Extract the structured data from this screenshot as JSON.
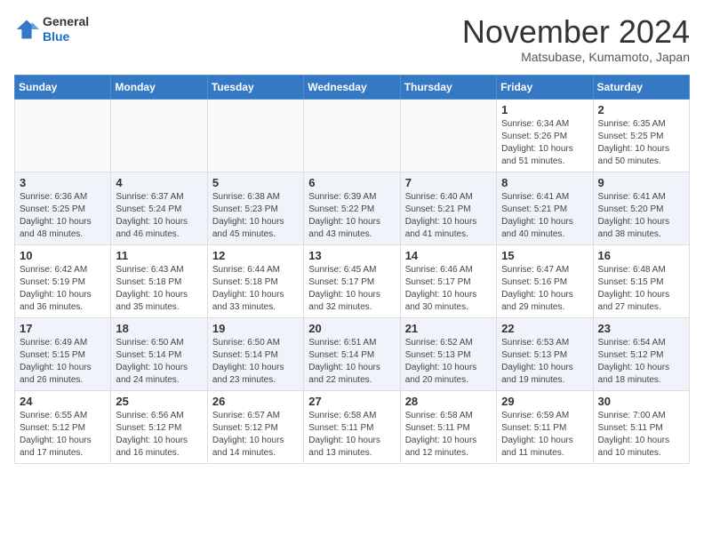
{
  "logo": {
    "general": "General",
    "blue": "Blue"
  },
  "title": "November 2024",
  "subtitle": "Matsubase, Kumamoto, Japan",
  "weekdays": [
    "Sunday",
    "Monday",
    "Tuesday",
    "Wednesday",
    "Thursday",
    "Friday",
    "Saturday"
  ],
  "weeks": [
    [
      {
        "day": "",
        "info": ""
      },
      {
        "day": "",
        "info": ""
      },
      {
        "day": "",
        "info": ""
      },
      {
        "day": "",
        "info": ""
      },
      {
        "day": "",
        "info": ""
      },
      {
        "day": "1",
        "info": "Sunrise: 6:34 AM\nSunset: 5:26 PM\nDaylight: 10 hours\nand 51 minutes."
      },
      {
        "day": "2",
        "info": "Sunrise: 6:35 AM\nSunset: 5:25 PM\nDaylight: 10 hours\nand 50 minutes."
      }
    ],
    [
      {
        "day": "3",
        "info": "Sunrise: 6:36 AM\nSunset: 5:25 PM\nDaylight: 10 hours\nand 48 minutes."
      },
      {
        "day": "4",
        "info": "Sunrise: 6:37 AM\nSunset: 5:24 PM\nDaylight: 10 hours\nand 46 minutes."
      },
      {
        "day": "5",
        "info": "Sunrise: 6:38 AM\nSunset: 5:23 PM\nDaylight: 10 hours\nand 45 minutes."
      },
      {
        "day": "6",
        "info": "Sunrise: 6:39 AM\nSunset: 5:22 PM\nDaylight: 10 hours\nand 43 minutes."
      },
      {
        "day": "7",
        "info": "Sunrise: 6:40 AM\nSunset: 5:21 PM\nDaylight: 10 hours\nand 41 minutes."
      },
      {
        "day": "8",
        "info": "Sunrise: 6:41 AM\nSunset: 5:21 PM\nDaylight: 10 hours\nand 40 minutes."
      },
      {
        "day": "9",
        "info": "Sunrise: 6:41 AM\nSunset: 5:20 PM\nDaylight: 10 hours\nand 38 minutes."
      }
    ],
    [
      {
        "day": "10",
        "info": "Sunrise: 6:42 AM\nSunset: 5:19 PM\nDaylight: 10 hours\nand 36 minutes."
      },
      {
        "day": "11",
        "info": "Sunrise: 6:43 AM\nSunset: 5:18 PM\nDaylight: 10 hours\nand 35 minutes."
      },
      {
        "day": "12",
        "info": "Sunrise: 6:44 AM\nSunset: 5:18 PM\nDaylight: 10 hours\nand 33 minutes."
      },
      {
        "day": "13",
        "info": "Sunrise: 6:45 AM\nSunset: 5:17 PM\nDaylight: 10 hours\nand 32 minutes."
      },
      {
        "day": "14",
        "info": "Sunrise: 6:46 AM\nSunset: 5:17 PM\nDaylight: 10 hours\nand 30 minutes."
      },
      {
        "day": "15",
        "info": "Sunrise: 6:47 AM\nSunset: 5:16 PM\nDaylight: 10 hours\nand 29 minutes."
      },
      {
        "day": "16",
        "info": "Sunrise: 6:48 AM\nSunset: 5:15 PM\nDaylight: 10 hours\nand 27 minutes."
      }
    ],
    [
      {
        "day": "17",
        "info": "Sunrise: 6:49 AM\nSunset: 5:15 PM\nDaylight: 10 hours\nand 26 minutes."
      },
      {
        "day": "18",
        "info": "Sunrise: 6:50 AM\nSunset: 5:14 PM\nDaylight: 10 hours\nand 24 minutes."
      },
      {
        "day": "19",
        "info": "Sunrise: 6:50 AM\nSunset: 5:14 PM\nDaylight: 10 hours\nand 23 minutes."
      },
      {
        "day": "20",
        "info": "Sunrise: 6:51 AM\nSunset: 5:14 PM\nDaylight: 10 hours\nand 22 minutes."
      },
      {
        "day": "21",
        "info": "Sunrise: 6:52 AM\nSunset: 5:13 PM\nDaylight: 10 hours\nand 20 minutes."
      },
      {
        "day": "22",
        "info": "Sunrise: 6:53 AM\nSunset: 5:13 PM\nDaylight: 10 hours\nand 19 minutes."
      },
      {
        "day": "23",
        "info": "Sunrise: 6:54 AM\nSunset: 5:12 PM\nDaylight: 10 hours\nand 18 minutes."
      }
    ],
    [
      {
        "day": "24",
        "info": "Sunrise: 6:55 AM\nSunset: 5:12 PM\nDaylight: 10 hours\nand 17 minutes."
      },
      {
        "day": "25",
        "info": "Sunrise: 6:56 AM\nSunset: 5:12 PM\nDaylight: 10 hours\nand 16 minutes."
      },
      {
        "day": "26",
        "info": "Sunrise: 6:57 AM\nSunset: 5:12 PM\nDaylight: 10 hours\nand 14 minutes."
      },
      {
        "day": "27",
        "info": "Sunrise: 6:58 AM\nSunset: 5:11 PM\nDaylight: 10 hours\nand 13 minutes."
      },
      {
        "day": "28",
        "info": "Sunrise: 6:58 AM\nSunset: 5:11 PM\nDaylight: 10 hours\nand 12 minutes."
      },
      {
        "day": "29",
        "info": "Sunrise: 6:59 AM\nSunset: 5:11 PM\nDaylight: 10 hours\nand 11 minutes."
      },
      {
        "day": "30",
        "info": "Sunrise: 7:00 AM\nSunset: 5:11 PM\nDaylight: 10 hours\nand 10 minutes."
      }
    ]
  ]
}
